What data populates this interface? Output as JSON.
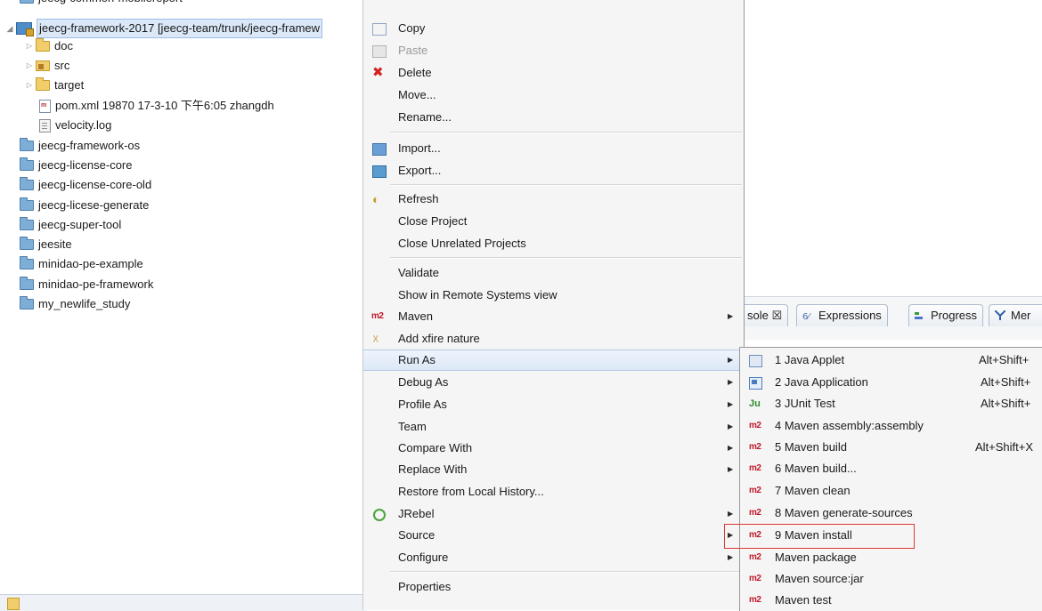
{
  "explorer": {
    "top_row_partial": "jeecg-common-mobilereport",
    "project_selected": "jeecg-framework-2017 [jeecg-team/trunk/jeecg-framew",
    "children": [
      {
        "label": "doc",
        "icon": "folder-icon",
        "twisty": "▷"
      },
      {
        "label": "src",
        "icon": "package-folder-icon",
        "twisty": "▷"
      },
      {
        "label": "target",
        "icon": "folder-icon",
        "twisty": "▷"
      },
      {
        "label": "pom.xml 19870  17-3-10 下午6:05  zhangdh",
        "icon": "xml-file-icon",
        "twisty": ""
      },
      {
        "label": "velocity.log",
        "icon": "log-file-icon",
        "twisty": ""
      }
    ],
    "projects": [
      "jeecg-framework-os",
      "jeecg-license-core",
      "jeecg-license-core-old",
      "jeecg-licese-generate",
      "jeecg-super-tool",
      "jeesite",
      "minidao-pe-example",
      "minidao-pe-framework",
      "my_newlife_study"
    ]
  },
  "background_tabs": {
    "console": "sole ☒",
    "expressions": "Expressions",
    "progress": "Progress",
    "mem": "Mer"
  },
  "context_menu": {
    "copy": "Copy",
    "paste": "Paste",
    "delete": "Delete",
    "move": "Move...",
    "rename": "Rename...",
    "import": "Import...",
    "export": "Export...",
    "refresh": "Refresh",
    "close_project": "Close Project",
    "close_unrelated": "Close Unrelated Projects",
    "validate": "Validate",
    "show_remote": "Show in Remote Systems view",
    "maven": "Maven",
    "add_xfire": "Add xfire nature",
    "run_as": "Run As",
    "debug_as": "Debug As",
    "profile_as": "Profile As",
    "team": "Team",
    "compare_with": "Compare With",
    "replace_with": "Replace With",
    "restore_history": "Restore from Local History...",
    "jrebel": "JRebel",
    "source": "Source",
    "configure": "Configure",
    "properties": "Properties",
    "m2_badge": "m2",
    "arrow": "▶"
  },
  "run_as_submenu": {
    "items": [
      {
        "label": "1 Java Applet",
        "shortcut": "Alt+Shift+",
        "icon": "java-applet-icon"
      },
      {
        "label": "2 Java Application",
        "shortcut": "Alt+Shift+",
        "icon": "java-application-icon"
      },
      {
        "label": "3 JUnit Test",
        "shortcut": "Alt+Shift+",
        "icon": "junit-icon"
      },
      {
        "label": "4 Maven assembly:assembly",
        "shortcut": "",
        "icon": "m2-icon"
      },
      {
        "label": "5 Maven build",
        "shortcut": "Alt+Shift+X",
        "icon": "m2-icon"
      },
      {
        "label": "6 Maven build...",
        "shortcut": "",
        "icon": "m2-icon"
      },
      {
        "label": "7 Maven clean",
        "shortcut": "",
        "icon": "m2-icon"
      },
      {
        "label": "8 Maven generate-sources",
        "shortcut": "",
        "icon": "m2-icon"
      },
      {
        "label": "9 Maven install",
        "shortcut": "",
        "icon": "m2-icon"
      },
      {
        "label": "Maven package",
        "shortcut": "",
        "icon": "m2-icon"
      },
      {
        "label": "Maven source:jar",
        "shortcut": "",
        "icon": "m2-icon"
      },
      {
        "label": "Maven test",
        "shortcut": "",
        "icon": "m2-icon"
      }
    ],
    "junit_glyph": "Ju",
    "m2_glyph": "m2"
  }
}
